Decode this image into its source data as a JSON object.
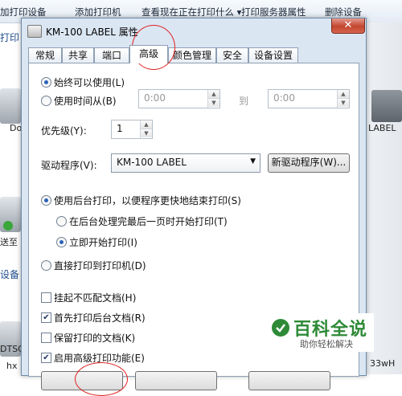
{
  "background": {
    "toolbar": [
      "加打印设备",
      "添加打印机",
      "查看现在正在打印什么 ▾",
      "打印服务器属性",
      "删除设备"
    ],
    "left_labels": [
      "打印",
      "Do",
      "送至",
      "设备",
      "DTSC",
      "hx"
    ],
    "right_labels": [
      "LABEL",
      "33wH"
    ]
  },
  "dialog": {
    "title": "KM-100 LABEL 属性",
    "close_label": "✕",
    "tabs": [
      "常规",
      "共享",
      "端口",
      "高级",
      "颜色管理",
      "安全",
      "设备设置"
    ],
    "active_tab": "高级",
    "always_available": "始终可以使用(L)",
    "available_from": "使用时间从(B)",
    "time_from": "0:00",
    "to_label": "到",
    "time_to": "0:00",
    "priority_label": "优先级(Y):",
    "priority_value": "1",
    "driver_label": "驱动程序(V):",
    "driver_value": "KM-100 LABEL",
    "new_driver_button": "新驱动程序(W)...",
    "spool_option": "使用后台打印，以便程序更快地结束打印(S)",
    "start_after_last_page": "在后台处理完最后一页时开始打印(T)",
    "start_immediately": "立即开始打印(I)",
    "print_direct": "直接打印到打印机(D)",
    "hold_mismatched": "挂起不匹配文档(H)",
    "print_spooled_first": "首先打印后台文档(R)",
    "keep_printed": "保留打印的文档(K)",
    "enable_advanced": "启用高级打印功能(E)",
    "checked": {
      "hold_mismatched": false,
      "print_spooled_first": true,
      "keep_printed": false,
      "enable_advanced": true
    }
  },
  "watermark": {
    "big": "百科全说",
    "small": "助你轻松解决"
  },
  "colors": {
    "annotation_red": "#e0201f",
    "watermark_green": "#2e8a37"
  }
}
